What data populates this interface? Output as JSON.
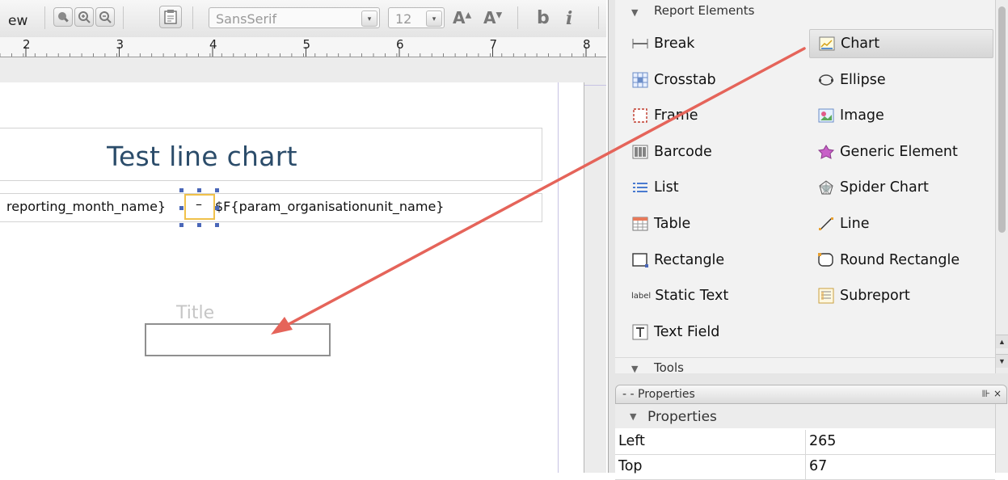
{
  "toolbar": {
    "view_label": "ew",
    "font_name": "SansSerif",
    "font_size": "12",
    "bold_glyph": "b",
    "italic_glyph": "i"
  },
  "ruler": {
    "ticks": [
      "2",
      "3",
      "4",
      "5",
      "6",
      "7",
      "8"
    ]
  },
  "report": {
    "title": "Test line chart",
    "field_left": "reporting_month_name}",
    "field_sep": "–",
    "field_right": "$F{param_organisationunit_name}",
    "chart_title_placeholder": "Title"
  },
  "palette": {
    "section_report_elements": "Report Elements",
    "section_tools": "Tools",
    "items": [
      {
        "label": "Break",
        "icon": "break-icon"
      },
      {
        "label": "Chart",
        "icon": "chart-icon"
      },
      {
        "label": "Crosstab",
        "icon": "crosstab-icon"
      },
      {
        "label": "Ellipse",
        "icon": "ellipse-icon"
      },
      {
        "label": "Frame",
        "icon": "frame-icon"
      },
      {
        "label": "Image",
        "icon": "image-icon"
      },
      {
        "label": "Barcode",
        "icon": "barcode-icon"
      },
      {
        "label": "Generic Element",
        "icon": "generic-element-icon"
      },
      {
        "label": "List",
        "icon": "list-icon"
      },
      {
        "label": "Spider Chart",
        "icon": "spider-chart-icon"
      },
      {
        "label": "Table",
        "icon": "table-icon"
      },
      {
        "label": "Line",
        "icon": "line-icon"
      },
      {
        "label": "Rectangle",
        "icon": "rectangle-icon"
      },
      {
        "label": "Round Rectangle",
        "icon": "round-rectangle-icon"
      },
      {
        "label": "Static Text",
        "icon": "static-text-icon",
        "icon_text": "label"
      },
      {
        "label": "Subreport",
        "icon": "subreport-icon"
      },
      {
        "label": "Text Field",
        "icon": "text-field-icon"
      }
    ]
  },
  "properties": {
    "panel_title": "- - Properties",
    "section": "Properties",
    "rows": [
      {
        "key": "Left",
        "value": "265"
      },
      {
        "key": "Top",
        "value": "67"
      }
    ]
  },
  "colors": {
    "title_color": "#2b4c6a",
    "selection_border": "#f0c14b",
    "handle_color": "#4a67b8",
    "arrow_color": "#e5645a"
  }
}
